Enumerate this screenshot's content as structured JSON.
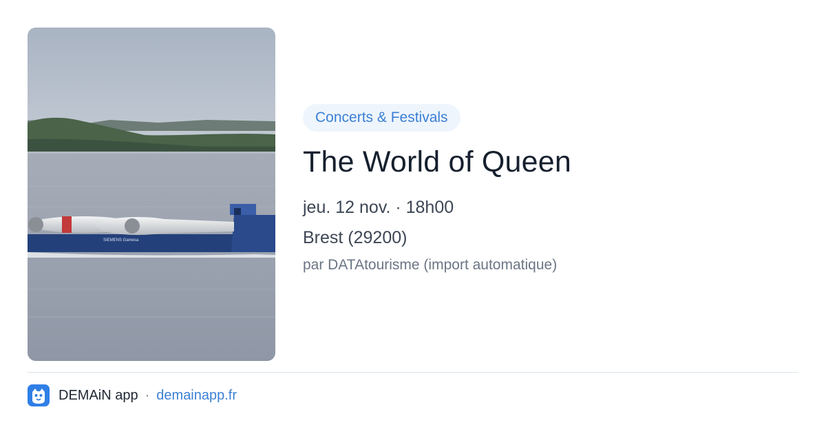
{
  "event": {
    "category": "Concerts & Festivals",
    "title": "The World of Queen",
    "datetime": "jeu. 12 nov. · 18h00",
    "location": "Brest (29200)",
    "source": "par DATAtourisme (import automatique)"
  },
  "image": {
    "subject": "cargo ship carrying wind turbine blades on a bay",
    "ship_text": "SIEMENS Gamesa"
  },
  "footer": {
    "brand": "DEMAiN app",
    "separator": "·",
    "site": "demainapp.fr",
    "logo_icon": "demain-app-logo-icon"
  },
  "colors": {
    "accent": "#3b7fd4",
    "tag_bg": "#eef5fc",
    "logo_bg": "#2f7fe6",
    "title": "#16202e"
  }
}
